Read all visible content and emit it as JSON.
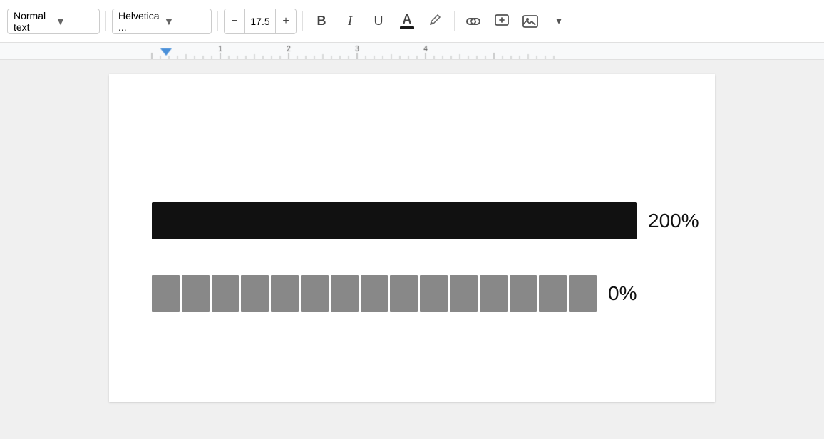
{
  "toolbar": {
    "text_style": {
      "label": "Normal text",
      "dropdown_arrow": "▼"
    },
    "font": {
      "label": "Helvetica ...",
      "dropdown_arrow": "▼"
    },
    "font_size": {
      "value": "17.5",
      "decrease_label": "−",
      "increase_label": "+"
    },
    "format_buttons": {
      "bold": "B",
      "italic": "I",
      "underline": "U"
    },
    "text_color": {
      "letter": "A"
    },
    "highlight_icon": "✏",
    "link_icon": "🔗",
    "insert_icon": "⊞",
    "image_icon": "🖼",
    "more_icon": "▾"
  },
  "ruler": {
    "marks": [
      "1",
      "1",
      "2",
      "3",
      "4"
    ]
  },
  "document": {
    "progress_bar_1": {
      "fill_percent": 100,
      "fill_color": "#111111",
      "track_color": "#111111",
      "label": "200%"
    },
    "progress_bar_2": {
      "segment_count": 15,
      "segment_color": "#888888",
      "label": "0%"
    }
  }
}
